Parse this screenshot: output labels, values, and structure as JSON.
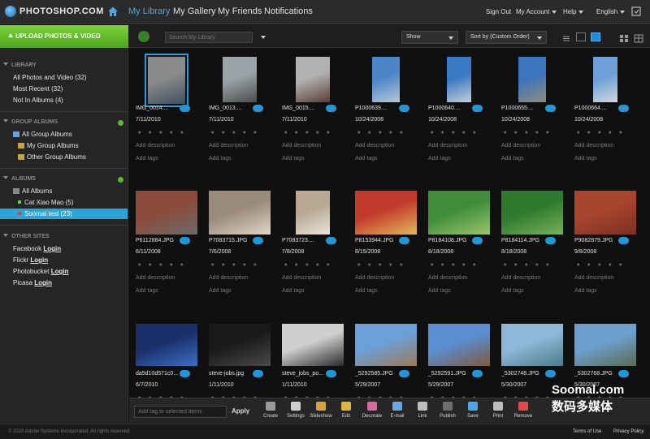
{
  "app": {
    "logo": "PHOTOSHOP.COM"
  },
  "nav": {
    "items": [
      "My Library",
      "My Gallery",
      "My Friends",
      "Notifications"
    ],
    "active": 0
  },
  "top_right": {
    "sign_out": "Sign Out",
    "my_account": "My Account",
    "help": "Help",
    "language": "English"
  },
  "toolbar": {
    "upload_label": "UPLOAD PHOTOS & VIDEO",
    "search_placeholder": "Search My Library",
    "show_label": "Show",
    "sort_label": "Sort by (Custom Order)"
  },
  "sidebar": {
    "library_head": "LIBRARY",
    "library_items": [
      "All Photos and Video (32)",
      "Most Recent (32)",
      "Not In Albums (4)"
    ],
    "group_head": "GROUP ALBUMS",
    "group_items": [
      "All Group Albums",
      "My Group Albums",
      "Other Group Albums"
    ],
    "albums_head": "ALBUMS",
    "albums_items": [
      "All Albums",
      "Cat Xiao Mao (5)",
      "Soomal test (23)"
    ],
    "other_head": "OTHER SITES",
    "other_sites": [
      {
        "name": "Facebook",
        "action": "Login"
      },
      {
        "name": "Flickr",
        "action": "Login"
      },
      {
        "name": "Photobucket",
        "action": "Login"
      },
      {
        "name": "Picasa",
        "action": "Login"
      }
    ]
  },
  "grid": {
    "add_description": "Add description",
    "add_tags": "Add tags",
    "stars": "★ ★ ★ ★ ★",
    "photos": [
      {
        "name": "IMG_0014....",
        "date": "7/11/2010",
        "c1": "#8a8a8a",
        "c2": "#3f4f5e"
      },
      {
        "name": "IMG_0013....",
        "date": "7/11/2010",
        "c1": "#9aa4a8",
        "c2": "#4b4b4b"
      },
      {
        "name": "IMG_0015....",
        "date": "7/11/2010",
        "c1": "#b1b1b1",
        "c2": "#5a3e36"
      },
      {
        "name": "P1000639....",
        "date": "10/24/2008",
        "c1": "#4c86c9",
        "c2": "#b8c7d6"
      },
      {
        "name": "P1000640....",
        "date": "10/24/2008",
        "c1": "#3a79c4",
        "c2": "#c4ced7"
      },
      {
        "name": "P1000655....",
        "date": "10/24/2008",
        "c1": "#3c74be",
        "c2": "#8c8d7c"
      },
      {
        "name": "P1000664....",
        "date": "10/24/2008",
        "c1": "#6da0d6",
        "c2": "#d0d8de"
      },
      {
        "name": "P6112884.JPG",
        "date": "6/11/2008",
        "c1": "#8c4b3a",
        "c2": "#6a6a6a"
      },
      {
        "name": "P7083715.JPG",
        "date": "7/6/2008",
        "c1": "#9a8b7a",
        "c2": "#e0d5c6"
      },
      {
        "name": "P7083723....",
        "date": "7/8/2008",
        "c1": "#b8a995",
        "c2": "#e9e3da"
      },
      {
        "name": "P8153944.JPG",
        "date": "8/15/2008",
        "c1": "#c23a2b",
        "c2": "#e2b85a"
      },
      {
        "name": "P8184108.JPG",
        "date": "8/18/2008",
        "c1": "#3f8d3a",
        "c2": "#9cc46a"
      },
      {
        "name": "P8184114.JPG",
        "date": "8/18/2008",
        "c1": "#2e7a2e",
        "c2": "#78b05a"
      },
      {
        "name": "P9082879.JPG",
        "date": "9/8/2008",
        "c1": "#a8452e",
        "c2": "#7d2f22"
      },
      {
        "name": "da5d10d571c0...",
        "date": "6/7/2010",
        "c1": "#1b2f6b",
        "c2": "#3b6fc4"
      },
      {
        "name": "steve-jobs.jpg",
        "date": "1/11/2010",
        "c1": "#1a1a1a",
        "c2": "#4a4a4a"
      },
      {
        "name": "steve_jobs_po...",
        "date": "1/11/2010",
        "c1": "#cfcfcf",
        "c2": "#2a2a2a"
      },
      {
        "name": "_5292585.JPG",
        "date": "5/29/2007",
        "c1": "#6ba0d8",
        "c2": "#9c7a58"
      },
      {
        "name": "_5292591.JPG",
        "date": "5/29/2007",
        "c1": "#5b8ed0",
        "c2": "#7d5a3e"
      },
      {
        "name": "_5302748.JPG",
        "date": "5/30/2007",
        "c1": "#8fb8d8",
        "c2": "#4a7a8a"
      },
      {
        "name": "_5302768.JPG",
        "date": "5/30/2007",
        "c1": "#6ea0cf",
        "c2": "#596b52"
      }
    ]
  },
  "bottom": {
    "tag_placeholder": "Add tag to selected items",
    "apply": "Apply",
    "tools": [
      "Create",
      "Settings",
      "Slideshow",
      "Edit",
      "Decorate",
      "E-mail",
      "Link",
      "Publish",
      "Save",
      "Print",
      "Remove"
    ]
  },
  "footer": {
    "copyright": "© 2010 Adobe Systems Incorporated. All rights reserved.",
    "terms": "Terms of Use",
    "privacy": "Privacy Policy"
  },
  "watermark": {
    "line1": "Soomal.com",
    "line2": "数码多媒体"
  }
}
